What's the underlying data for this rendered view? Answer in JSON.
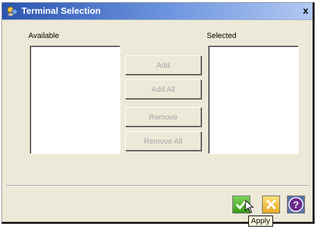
{
  "window": {
    "title": "Terminal Selection",
    "close_glyph": "x"
  },
  "lists": {
    "available_label": "Available",
    "selected_label": "Selected"
  },
  "buttons": {
    "add": "Add",
    "add_all": "Add All",
    "remove": "Remove",
    "remove_all": "Remove All"
  },
  "footer": {
    "apply_tooltip": "Apply"
  },
  "colors": {
    "apply_green": "#49b025",
    "cancel_yellow": "#f3c53a",
    "help_purple": "#6b2a8c"
  }
}
